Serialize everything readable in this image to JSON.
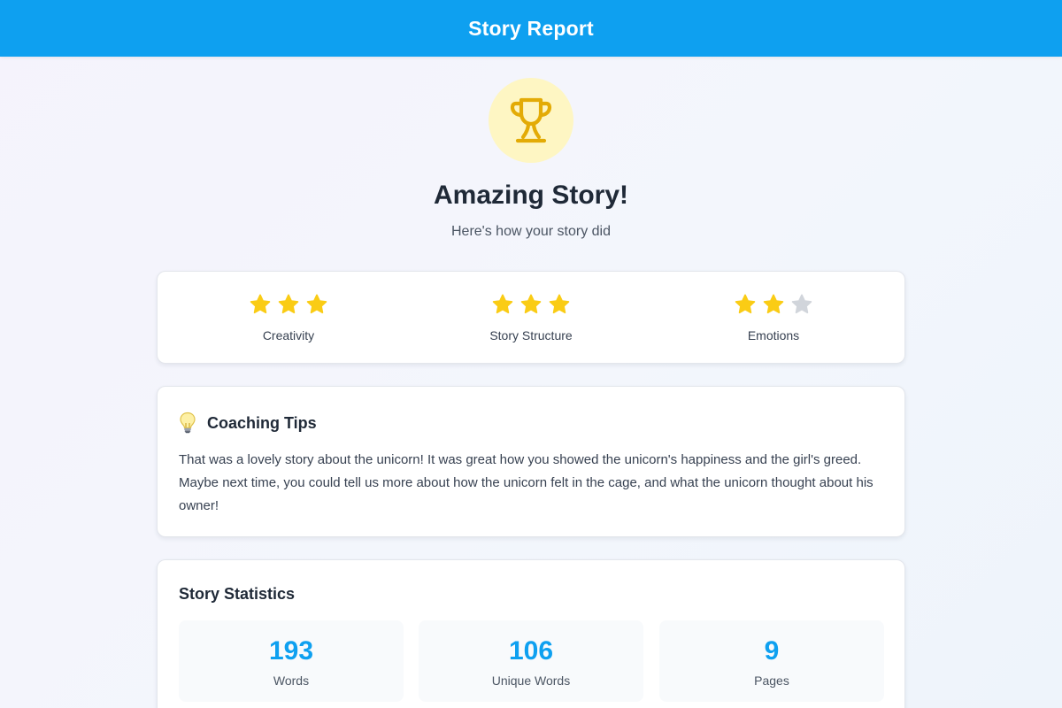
{
  "header": {
    "title": "Story Report"
  },
  "hero": {
    "icon": "trophy-icon",
    "title": "Amazing Story!",
    "subtitle": "Here's how your story did"
  },
  "ratings": [
    {
      "label": "Creativity",
      "stars": 3,
      "max": 3
    },
    {
      "label": "Story Structure",
      "stars": 3,
      "max": 3
    },
    {
      "label": "Emotions",
      "stars": 2,
      "max": 3
    }
  ],
  "tips": {
    "icon": "lightbulb-icon",
    "title": "Coaching Tips",
    "body": "That was a lovely story about the unicorn! It was great how you showed the unicorn's happiness and the girl's greed. Maybe next time, you could tell us more about how the unicorn felt in the cage, and what the unicorn thought about his owner!"
  },
  "stats": {
    "title": "Story Statistics",
    "items": [
      {
        "value": "193",
        "label": "Words"
      },
      {
        "value": "106",
        "label": "Unique Words"
      },
      {
        "value": "9",
        "label": "Pages"
      }
    ]
  },
  "colors": {
    "header": "#0ea0f0",
    "star_filled": "#facc15",
    "star_empty": "#d1d5db",
    "trophy": "#e3ab06",
    "trophy_bg": "#fef6c3",
    "stat_value": "#0ea0f0"
  }
}
